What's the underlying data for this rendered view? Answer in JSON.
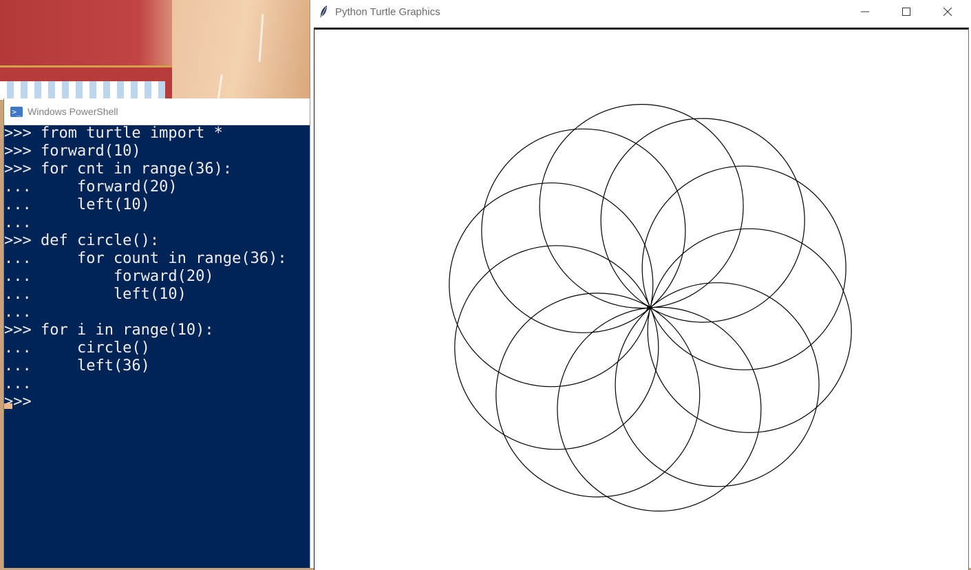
{
  "powershell": {
    "title": "Windows PowerShell",
    "icon": "powershell-icon",
    "background": "#012456",
    "text_color": "#eeedf0",
    "lines": [
      ">>> from turtle import *",
      ">>> forward(10)",
      ">>> for cnt in range(36):",
      "...     forward(20)",
      "...     left(10)",
      "...",
      ">>> def circle():",
      "...     for count in range(36):",
      "...         forward(20)",
      "...         left(10)",
      "...",
      ">>> for i in range(10):",
      "...     circle()",
      "...     left(36)",
      "...",
      ">>>"
    ]
  },
  "turtle_window": {
    "title": "Python Turtle Graphics",
    "icon": "feather-icon",
    "minimize_icon": "minimize-icon",
    "maximize_icon": "maximize-icon",
    "close_icon": "close-icon",
    "drawing": {
      "circle_count": 10,
      "rotation_step_deg": 36,
      "stroke_color": "#000000"
    }
  }
}
